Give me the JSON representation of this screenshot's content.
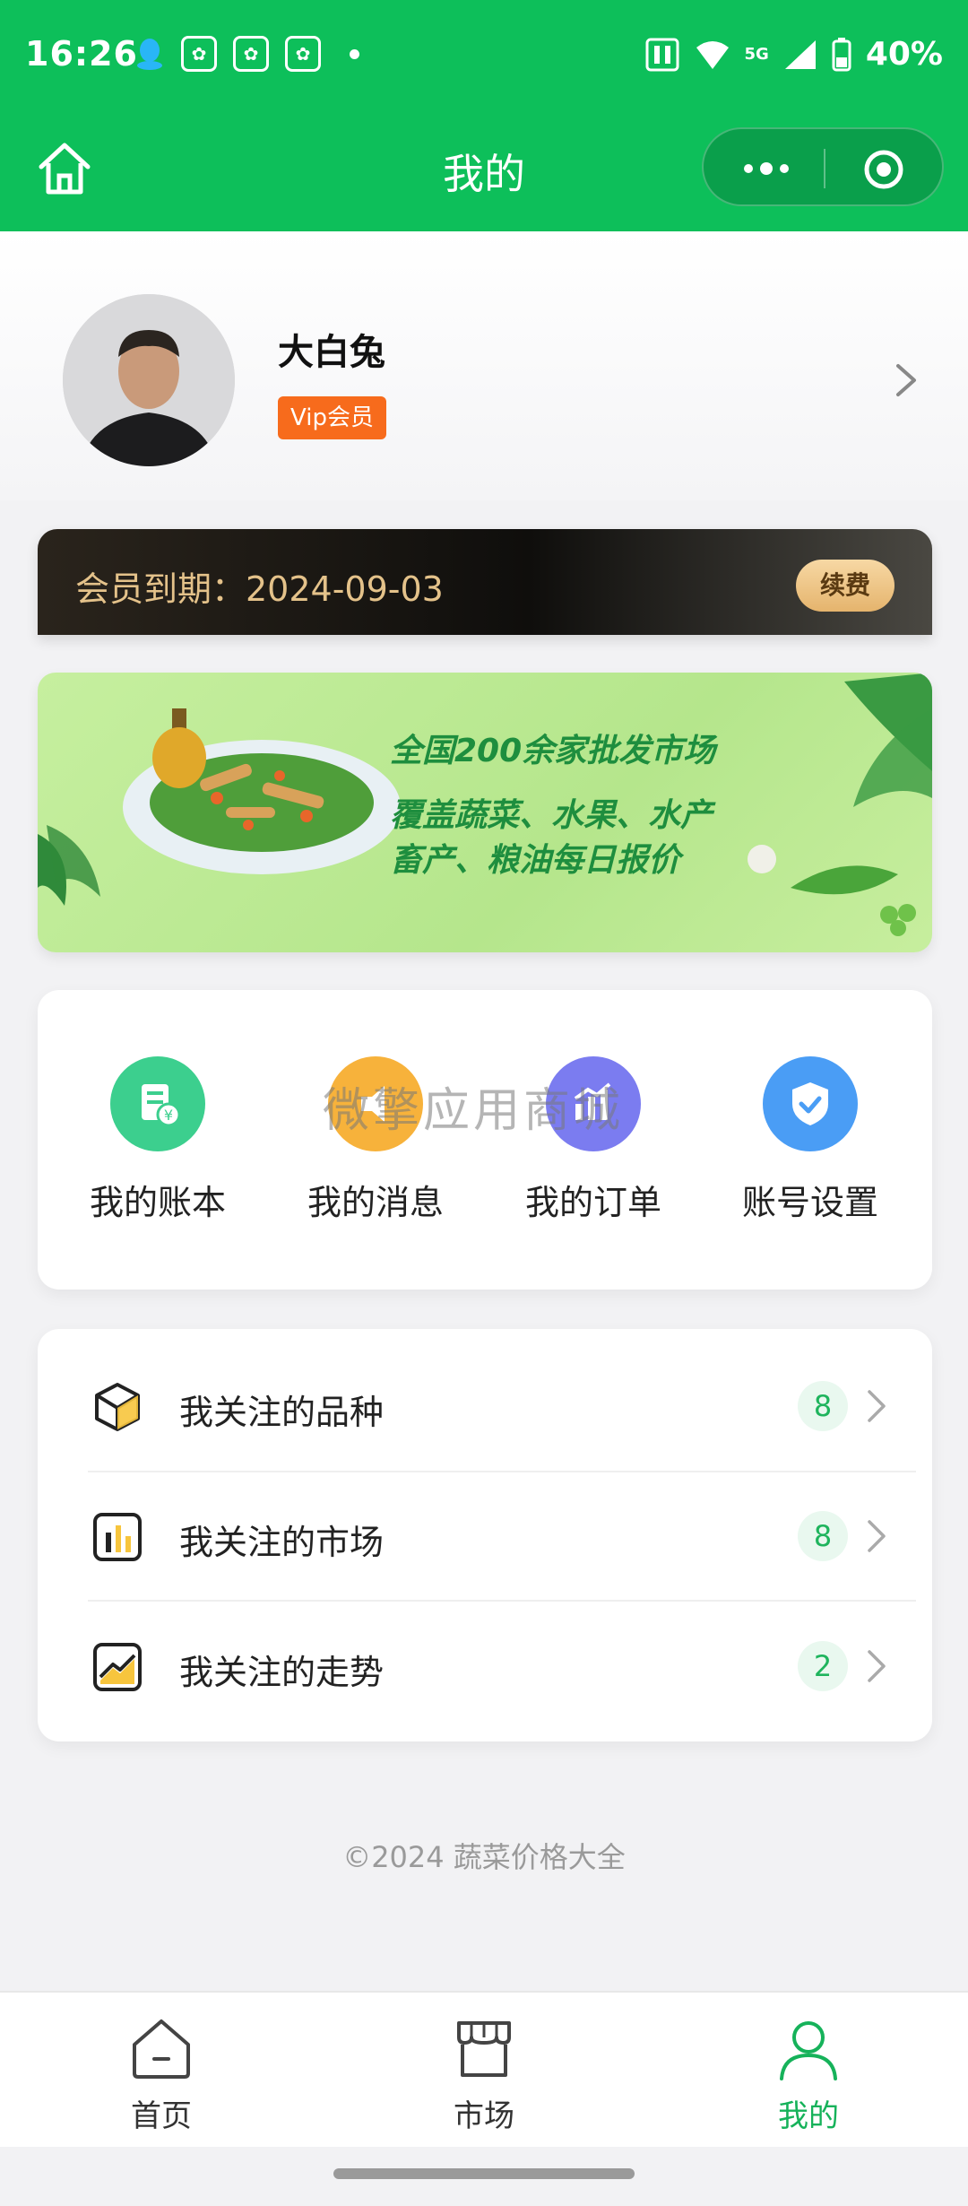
{
  "status_bar": {
    "time": "16:26",
    "battery_percent": "40%",
    "network": "5G",
    "icons": [
      "qq-icon",
      "baidu-icon",
      "baidu-icon",
      "baidu-icon",
      "notification-dot",
      "nfc-icon",
      "wifi-icon",
      "signal-icon",
      "battery-icon"
    ]
  },
  "nav": {
    "title": "我的",
    "accent": "#0dbf5a"
  },
  "profile": {
    "name": "大白兔",
    "badge": "Vip会员"
  },
  "membership": {
    "expiry_text": "会员到期：2024-09-03",
    "renew_label": "续费"
  },
  "banner": {
    "line1": "全国200余家批发市场",
    "line2": "覆盖蔬菜、水果、水产",
    "line3": "畜产、粮油每日报价"
  },
  "quick_actions": [
    {
      "label": "我的账本",
      "icon": "ledger-icon",
      "color": "#3ccf8e"
    },
    {
      "label": "我的消息",
      "icon": "message-icon",
      "color": "#f7b23b"
    },
    {
      "label": "我的订单",
      "icon": "order-icon",
      "color": "#7b7cf0"
    },
    {
      "label": "账号设置",
      "icon": "shield-icon",
      "color": "#4a9df5"
    }
  ],
  "watermark": "微擎应用商城",
  "follow_list": [
    {
      "label": "我关注的品种",
      "count": "8",
      "icon": "cube-icon"
    },
    {
      "label": "我关注的市场",
      "count": "8",
      "icon": "bar-chart-icon"
    },
    {
      "label": "我关注的走势",
      "count": "2",
      "icon": "trend-icon"
    }
  ],
  "copyright": "©2024 蔬菜价格大全",
  "tabbar": [
    {
      "label": "首页",
      "icon": "home-icon",
      "active": false
    },
    {
      "label": "市场",
      "icon": "store-icon",
      "active": false
    },
    {
      "label": "我的",
      "icon": "user-icon",
      "active": true
    }
  ]
}
